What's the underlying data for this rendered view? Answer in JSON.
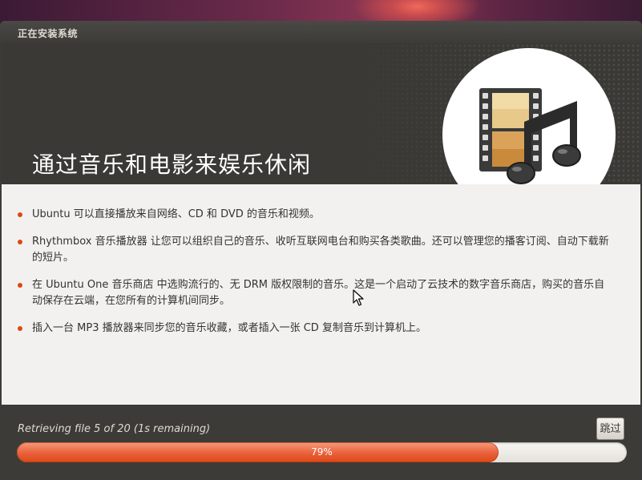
{
  "window": {
    "title": "正在安装系统"
  },
  "banner": {
    "title": "通过音乐和电影来娱乐休闲",
    "icon": "music-video-icon"
  },
  "bullets": [
    "Ubuntu 可以直接播放来自网络、CD 和 DVD 的音乐和视频。",
    "Rhythmbox 音乐播放器 让您可以组织自己的音乐、收听互联网电台和购买各类歌曲。还可以管理您的播客订阅、自动下载新的短片。",
    "在 Ubuntu One 音乐商店 中选购流行的、无 DRM 版权限制的音乐。这是一个启动了云技术的数字音乐商店，购买的音乐自动保存在云端，在您所有的计算机间同步。",
    "插入一台 MP3 播放器来同步您的音乐收藏，或者插入一张 CD 复制音乐到计算机上。"
  ],
  "footer": {
    "status": "Retrieving file 5 of 20 (1s remaining)",
    "skip_label": "跳过",
    "progress_percent": 79,
    "progress_label": "79%"
  },
  "colors": {
    "accent": "#dd4814",
    "window_bg": "#3c3b37",
    "content_bg": "#f2f1f0"
  }
}
